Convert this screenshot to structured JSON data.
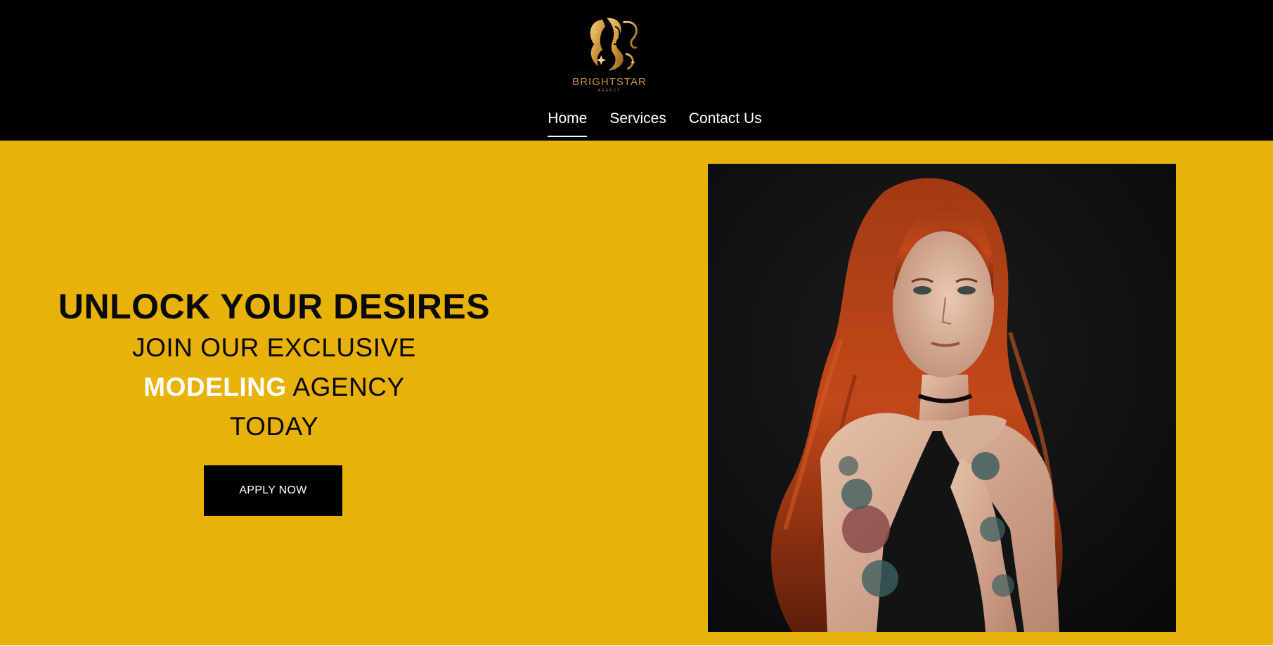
{
  "logo": {
    "name": "BRIGHTSTAR",
    "subtitle": "AGENCY",
    "icon": "woman-silhouette-logo-icon"
  },
  "nav": {
    "items": [
      {
        "label": "Home",
        "active": true
      },
      {
        "label": "Services",
        "active": false
      },
      {
        "label": "Contact Us",
        "active": false
      }
    ]
  },
  "hero": {
    "headline": "UNLOCK YOUR DESIRES",
    "line1": "JOIN OUR EXCLUSIVE",
    "line2_bold": "MODELING",
    "line2_rest": " AGENCY",
    "line3": "TODAY",
    "cta_label": "APPLY NOW",
    "photo": "red-haired-tattooed-woman-portrait"
  },
  "colors": {
    "header_bg": "#000000",
    "hero_bg": "#e8b20a",
    "logo_gold": "#c8923f",
    "cta_bg": "#000000"
  }
}
